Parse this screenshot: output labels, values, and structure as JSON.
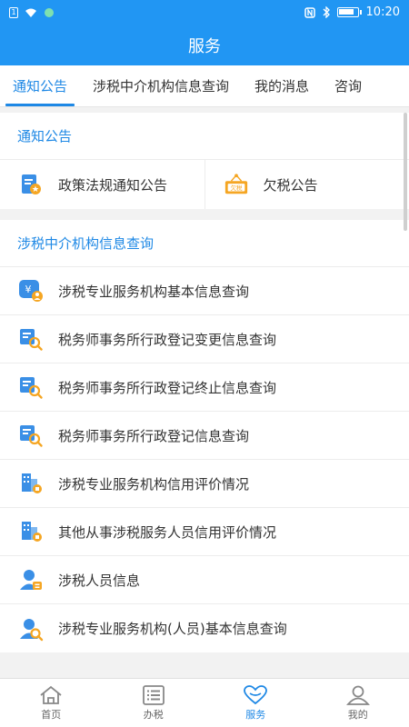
{
  "status_bar": {
    "sim_label": "1",
    "time": "10:20"
  },
  "title": "服务",
  "tabs": [
    {
      "label": "通知公告",
      "active": true
    },
    {
      "label": "涉税中介机构信息查询",
      "active": false
    },
    {
      "label": "我的消息",
      "active": false
    },
    {
      "label": "咨询",
      "active": false
    }
  ],
  "notice_section": {
    "title": "通知公告",
    "items": [
      {
        "label": "政策法规通知公告",
        "icon": "document-star-icon"
      },
      {
        "label": "欠税公告",
        "icon": "tax-arrears-sign-icon",
        "sign_text": "欠税"
      }
    ]
  },
  "agency_section": {
    "title": "涉税中介机构信息查询",
    "items": [
      {
        "label": "涉税专业服务机构基本信息查询",
        "icon": "yuan-person-icon"
      },
      {
        "label": "税务师事务所行政登记变更信息查询",
        "icon": "tax-search-icon"
      },
      {
        "label": "税务师事务所行政登记终止信息查询",
        "icon": "tax-search-icon"
      },
      {
        "label": "税务师事务所行政登记信息查询",
        "icon": "tax-search-icon"
      },
      {
        "label": "涉税专业服务机构信用评价情况",
        "icon": "building-badge-icon"
      },
      {
        "label": "其他从事涉税服务人员信用评价情况",
        "icon": "building-badge-icon"
      },
      {
        "label": "涉税人员信息",
        "icon": "person-tax-icon"
      },
      {
        "label": "涉税专业服务机构(人员)基本信息查询",
        "icon": "person-search-icon"
      }
    ]
  },
  "bottom_nav": [
    {
      "label": "首页",
      "icon": "home-icon",
      "active": false
    },
    {
      "label": "办税",
      "icon": "list-icon",
      "active": false
    },
    {
      "label": "服务",
      "icon": "heart-icon",
      "active": true
    },
    {
      "label": "我的",
      "icon": "user-icon",
      "active": false
    }
  ],
  "colors": {
    "primary": "#2196f3",
    "accent": "#1e88e5",
    "icon_blue": "#3a8fe6",
    "icon_orange": "#f5a623"
  }
}
